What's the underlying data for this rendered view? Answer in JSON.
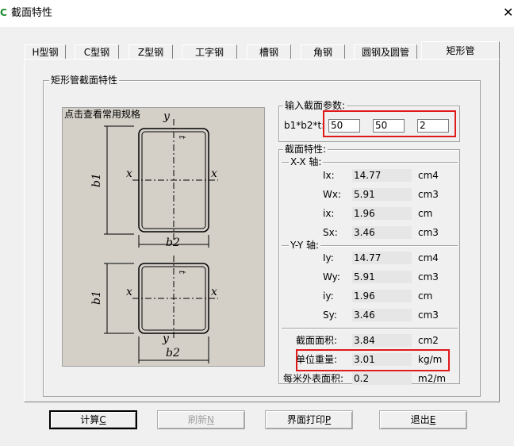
{
  "window": {
    "title": "截面特性"
  },
  "tabs": [
    {
      "label": "H型钢"
    },
    {
      "label": "C型钢"
    },
    {
      "label": "Z型钢"
    },
    {
      "label": "工字钢"
    },
    {
      "label": "槽钢"
    },
    {
      "label": "角钢"
    },
    {
      "label": "圆钢及圆管"
    },
    {
      "label": "矩形管"
    }
  ],
  "section_group": {
    "title": "矩形管截面特性",
    "diagram_caption": "点击查看常用规格"
  },
  "input_group": {
    "title": "输入截面参数:",
    "label": "b1*b2*t:",
    "b1": "50",
    "b2": "50",
    "t": "2"
  },
  "props_group": {
    "title": "截面特性:",
    "xx_title": "X-X 轴:",
    "xx": [
      {
        "name": "Ix:",
        "value": "14.77",
        "unit": "cm4"
      },
      {
        "name": "Wx:",
        "value": "5.91",
        "unit": "cm3"
      },
      {
        "name": "ix:",
        "value": "1.96",
        "unit": "cm"
      },
      {
        "name": "Sx:",
        "value": "3.46",
        "unit": "cm3"
      }
    ],
    "yy_title": "Y-Y 轴:",
    "yy": [
      {
        "name": "Iy:",
        "value": "14.77",
        "unit": "cm4"
      },
      {
        "name": "Wy:",
        "value": "5.91",
        "unit": "cm3"
      },
      {
        "name": "iy:",
        "value": "1.96",
        "unit": "cm"
      },
      {
        "name": "Sy:",
        "value": "3.46",
        "unit": "cm3"
      }
    ],
    "area": {
      "name": "截面面积:",
      "value": "3.84",
      "unit": "cm2"
    },
    "weight": {
      "name": "单位重量:",
      "value": "3.01",
      "unit": "kg/m"
    },
    "surface": {
      "name": "每米外表面积:",
      "value": "0.2",
      "unit": "m2/m"
    }
  },
  "diagram_labels": {
    "x": "x",
    "y": "y",
    "t": "t",
    "b1": "b1",
    "b2": "b2"
  },
  "buttons": {
    "calc": {
      "text": "计算",
      "key": "C"
    },
    "refresh": {
      "text": "刷新",
      "key": "N"
    },
    "print": {
      "text": "界面打印",
      "key": "P"
    },
    "exit": {
      "text": "退出",
      "key": "E"
    }
  },
  "colors": {
    "highlight": "#e0191b",
    "diagram_bg": "#d4d0c8"
  }
}
